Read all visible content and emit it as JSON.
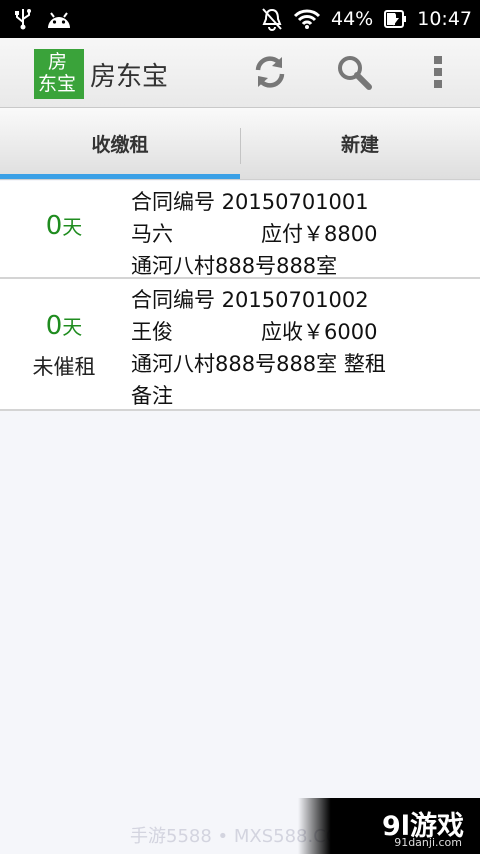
{
  "status_bar": {
    "icons_left": [
      "usb-icon",
      "android-icon"
    ],
    "icons_right": [
      "mute-icon",
      "wifi-icon",
      "battery-charging-icon"
    ],
    "battery": "44%",
    "time": "10:47"
  },
  "action_bar": {
    "logo_line1": "房",
    "logo_line2": "东宝",
    "title": "房东宝",
    "icons": [
      "refresh-icon",
      "search-icon",
      "overflow-menu-icon"
    ],
    "accent_color": "#3aa33a"
  },
  "tabs": [
    {
      "label": "收缴租",
      "selected": true
    },
    {
      "label": "新建",
      "selected": false
    }
  ],
  "list": [
    {
      "days_num": "0",
      "days_unit": "天",
      "contract": "合同编号 20150701001",
      "name": "马六",
      "amount": "应付￥8800",
      "address": "通河八村888号888室"
    },
    {
      "days_num": "0",
      "days_unit": "天",
      "status": "未催租",
      "contract": "合同编号 20150701002",
      "name": "王俊",
      "amount": "应收￥6000",
      "address": "通河八村888号888室 整租",
      "note": "备注"
    }
  ],
  "watermark": {
    "faint_text": "手游5588 • MXS588.COM",
    "logo": "9l游戏",
    "site": "91danji.com"
  }
}
